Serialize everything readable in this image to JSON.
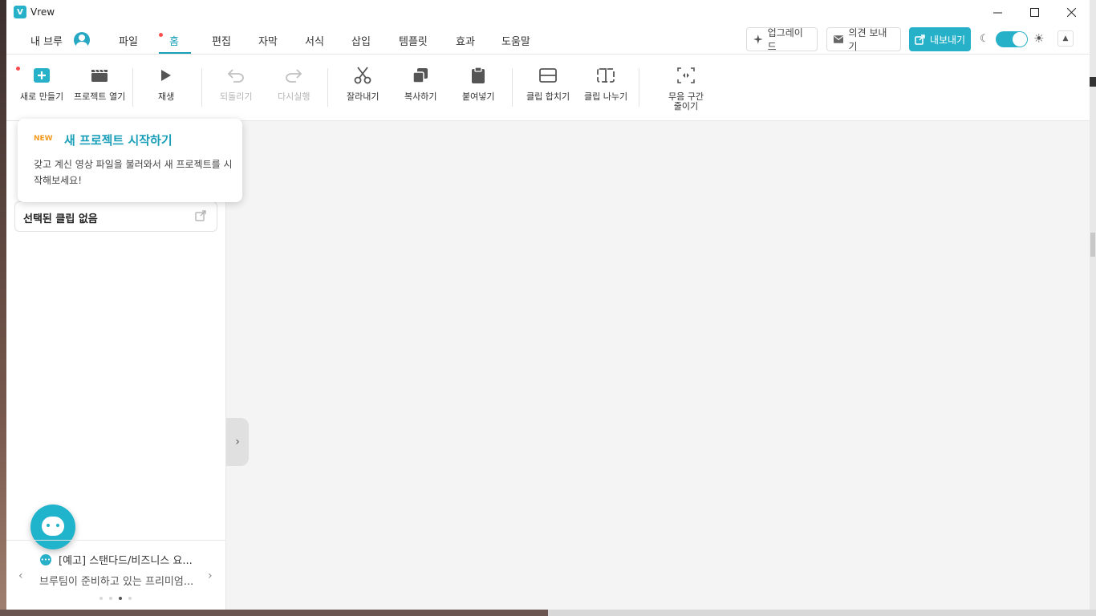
{
  "window": {
    "app_title": "Vrew",
    "logo_text": "V"
  },
  "menubar": {
    "user_label": "내 브루",
    "tabs": [
      {
        "label": "파일"
      },
      {
        "label": "홈",
        "active": true
      },
      {
        "label": "편집"
      },
      {
        "label": "자막"
      },
      {
        "label": "서식"
      },
      {
        "label": "삽입"
      },
      {
        "label": "템플릿"
      },
      {
        "label": "효과"
      },
      {
        "label": "도움말"
      }
    ],
    "upgrade_label": "업그레이드",
    "feedback_label": "의견 보내기",
    "export_label": "내보내기",
    "theme_toggle_on": true
  },
  "toolbar": {
    "new": "새로 만들기",
    "open": "프로젝트 열기",
    "play": "재생",
    "undo": "되돌리기",
    "redo": "다시실행",
    "cut": "잘라내기",
    "copy": "복사하기",
    "paste": "붙여넣기",
    "merge": "클립 합치기",
    "split": "클립 나누기",
    "silence_line1": "무음 구간",
    "silence_line2": "줄이기"
  },
  "popup": {
    "badge": "NEW",
    "title": "새 프로젝트 시작하기",
    "description": "갖고 계신 영상 파일을 불러와서 새 프로젝트를 시작해보세요!"
  },
  "leftpanel": {
    "clip_status": "선택된 클립 없음"
  },
  "notice": {
    "title": "[예고] 스탠다드/비즈니스 요...",
    "body": "브루팀이 준비하고 있는 프리미엄...",
    "page_count": 4,
    "current_page": 3
  },
  "colors": {
    "accent": "#1a9fb8",
    "button_teal": "#27b1c9",
    "badge_orange": "#f39a1e",
    "dot_red": "#ff4d4d"
  }
}
